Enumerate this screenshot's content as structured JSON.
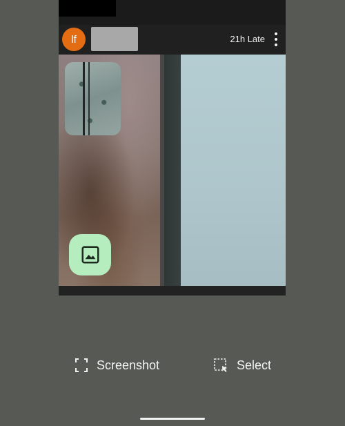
{
  "card": {
    "avatar_initials": "lf",
    "status": "21h Late",
    "avatar_color": "#e46d14",
    "fab_color": "#b6edbf"
  },
  "actions": {
    "screenshot_label": "Screenshot",
    "select_label": "Select"
  },
  "icons": {
    "more": "more-vert-icon",
    "image": "image-icon",
    "screenshot": "screenshot-icon",
    "select": "select-icon"
  },
  "colors": {
    "background": "#575955",
    "text": "#f3f3f3"
  }
}
